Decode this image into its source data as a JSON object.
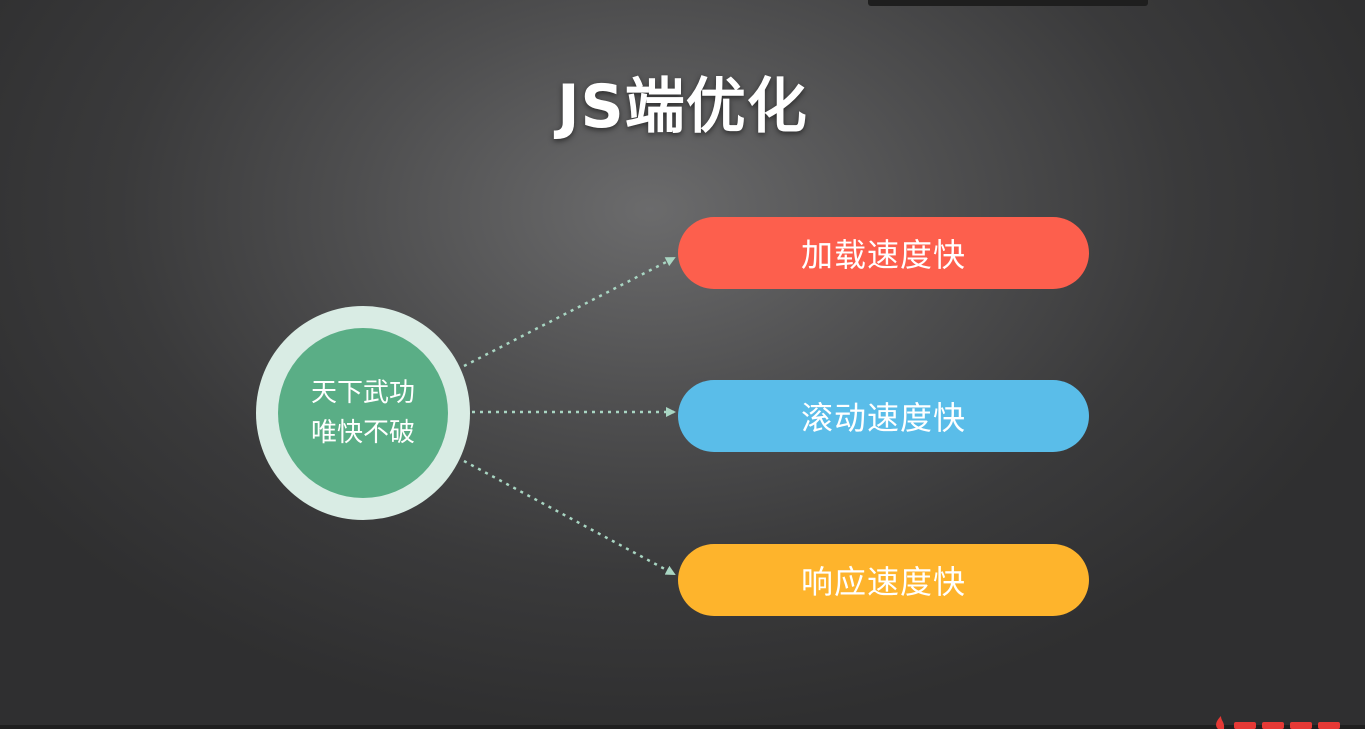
{
  "title": "JS端优化",
  "center": {
    "line1": "天下武功",
    "line2": "唯快不破",
    "outer_color": "#d9ece4",
    "inner_color": "#5aae86"
  },
  "outcomes": [
    {
      "label": "加载速度快",
      "color": "#fd5f4d"
    },
    {
      "label": "滚动速度快",
      "color": "#5abde9"
    },
    {
      "label": "响应速度快",
      "color": "#feb42c"
    }
  ],
  "connector_color": "#a9d6c3",
  "watermark": {
    "icon": "flame-logo-icon",
    "color": "#e53935"
  }
}
